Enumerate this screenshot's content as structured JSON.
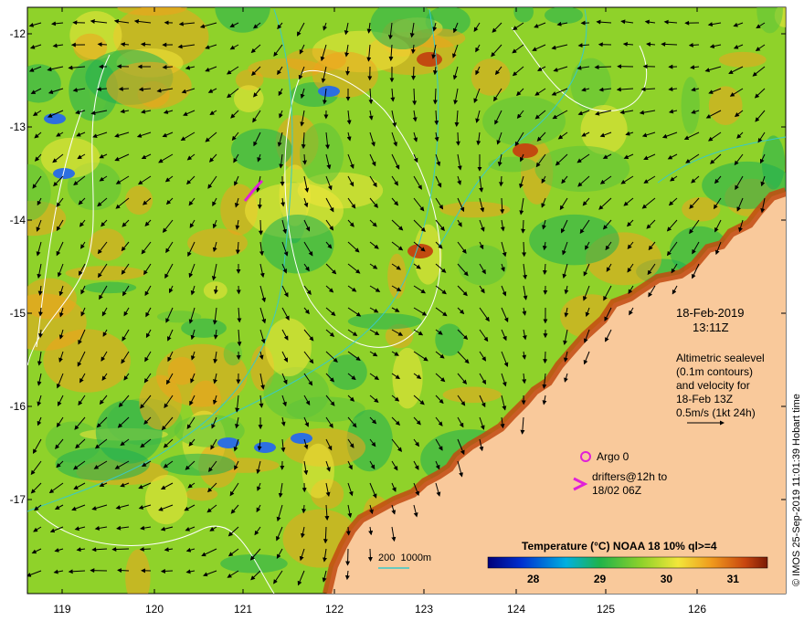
{
  "map": {
    "y_ticks": [
      "-12",
      "-13",
      "-14",
      "-15",
      "-16",
      "-17"
    ],
    "x_ticks": [
      "119",
      "120",
      "121",
      "122",
      "123",
      "124",
      "125",
      "126"
    ],
    "date_line1": "18-Feb-2019",
    "date_line2": "13:11Z",
    "alt_lines": [
      "Altimetric sealevel",
      "(0.1m contours)",
      "and velocity for",
      "18-Feb 13Z",
      "0.5m/s (1kt 24h)"
    ],
    "argo_label": "Argo 0",
    "drifter_line1": "drifters@12h to",
    "drifter_line2": "18/02 06Z",
    "depth_label": "200  1000m",
    "colorbar_title": "Temperature (°C) NOAA 18 10% ql>=4",
    "colorbar_ticks": [
      "28",
      "29",
      "30",
      "31"
    ],
    "colorbar_range": [
      27.3,
      31.5
    ],
    "side_credit": "© IMOS 25-Sep-2019 11:01:39 Hobart time",
    "colors": {
      "land": "#f9c99b",
      "ocean_base": "#8fd22a",
      "warm": "#f0a21d",
      "hot": "#c24a10",
      "cool": "#1fae52",
      "cold_patch": "#2d6fe0",
      "marker": "#e020d8",
      "contour": "#ffffff",
      "isobath": "#38c9c9"
    }
  }
}
